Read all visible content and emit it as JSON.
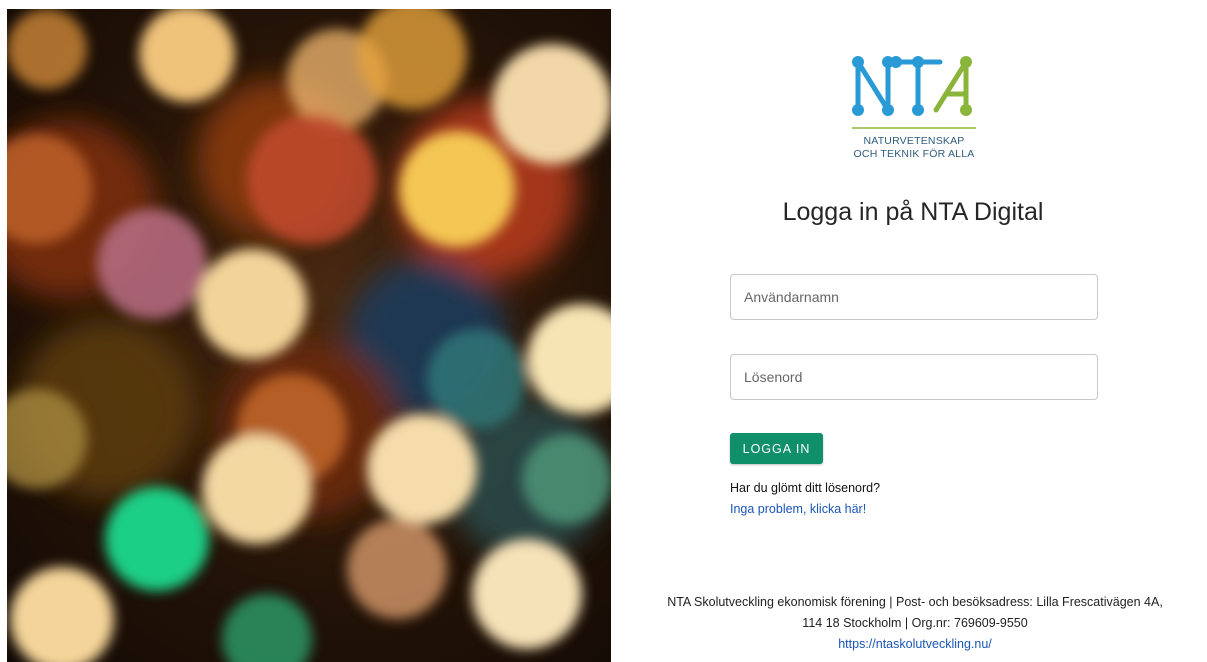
{
  "logo": {
    "letters": "NTA",
    "line1": "NATURVETENSKAP",
    "line2": "OCH TEKNIK FÖR ALLA",
    "colors": {
      "blue": "#2a9ad6",
      "green": "#8bb53a"
    }
  },
  "login": {
    "title": "Logga in på NTA Digital",
    "username_placeholder": "Användarnamn",
    "password_placeholder": "Lösenord",
    "button_label": "LOGGA IN",
    "forgot_text": "Har du glömt ditt lösenord?",
    "forgot_link": "Inga problem, klicka här!",
    "button_color": "#0f8f6a"
  },
  "footer": {
    "line1": "NTA Skolutveckling ekonomisk förening | Post- och besöksadress: Lilla Frescativägen 4A,",
    "line2": "114 18 Stockholm | Org.nr: 769609-9550",
    "url": "https://ntaskolutveckling.nu/"
  }
}
